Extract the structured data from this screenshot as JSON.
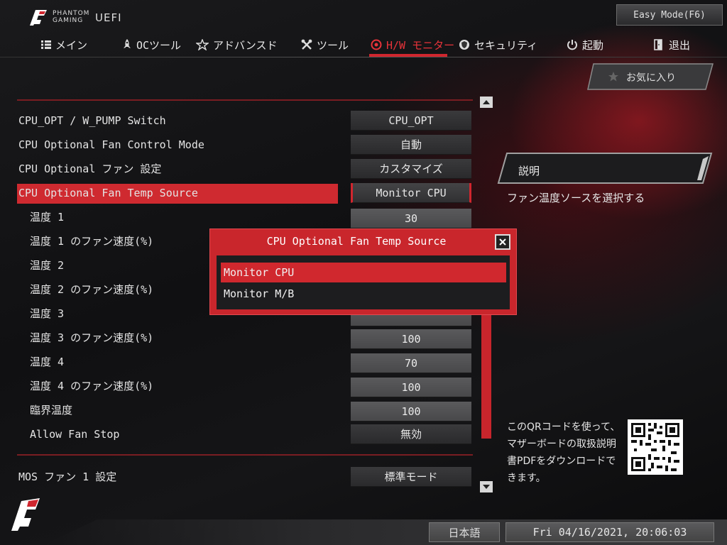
{
  "brand": {
    "line1": "PHANTOM",
    "line2": "GAMING",
    "uefi": "UEFI"
  },
  "easy_mode_label": "Easy Mode(F6)",
  "menu": [
    {
      "label": "メイン",
      "icon": "list-icon",
      "active": false
    },
    {
      "label": "OCツール",
      "icon": "rocket-icon",
      "active": false
    },
    {
      "label": "アドバンスド",
      "icon": "star-icon",
      "active": false
    },
    {
      "label": "ツール",
      "icon": "tools-icon",
      "active": false
    },
    {
      "label": "H/W モニター",
      "icon": "monitor-gauge-icon",
      "active": true
    },
    {
      "label": "セキュリティ",
      "icon": "shield-icon",
      "active": false
    },
    {
      "label": "起動",
      "icon": "power-icon",
      "active": false
    },
    {
      "label": "退出",
      "icon": "exit-door-icon",
      "active": false
    }
  ],
  "favorite_label": "お気に入り",
  "settings": [
    {
      "label": "CPU_OPT / W_PUMP Switch",
      "value": "CPU_OPT"
    },
    {
      "label": "CPU Optional Fan Control Mode",
      "value": "自動"
    },
    {
      "label": "CPU Optional ファン 設定",
      "value": "カスタマイズ"
    },
    {
      "label": "CPU Optional Fan Temp Source",
      "value": "Monitor CPU"
    },
    {
      "label": "温度 1",
      "value": "30"
    },
    {
      "label": "温度 1 のファン速度(%)",
      "value": ""
    },
    {
      "label": "温度 2",
      "value": ""
    },
    {
      "label": "温度 2 のファン速度(%)",
      "value": ""
    },
    {
      "label": "温度 3",
      "value": ""
    },
    {
      "label": "温度 3 のファン速度(%)",
      "value": "100"
    },
    {
      "label": "温度 4",
      "value": "70"
    },
    {
      "label": "温度 4 のファン速度(%)",
      "value": "100"
    },
    {
      "label": "臨界温度",
      "value": "100"
    },
    {
      "label": "Allow Fan Stop",
      "value": "無効"
    },
    {
      "label": "MOS ファン 1 設定",
      "value": "標準モード"
    }
  ],
  "description": {
    "header": "説明",
    "text": "ファン温度ソースを選択する"
  },
  "qr_text": "このQRコードを使って、マザーボードの取扱説明書PDFをダウンロードできます。",
  "popup": {
    "title": "CPU Optional Fan Temp Source",
    "options": [
      "Monitor CPU",
      "Monitor M/B"
    ],
    "selected": "Monitor CPU"
  },
  "footer": {
    "language": "日本語",
    "datetime": "Fri 04/16/2021, 20:06:03"
  },
  "colors": {
    "accent": "#d0262e",
    "bg": "#0c0c0d"
  }
}
